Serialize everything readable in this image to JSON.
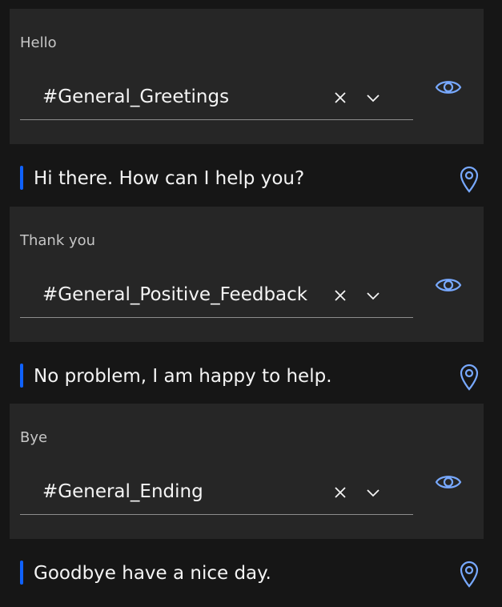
{
  "colors": {
    "background": "#161616",
    "card": "#262626",
    "accent": "#0f62fe",
    "icon": "#78a9ff"
  },
  "blocks": [
    {
      "label": "Hello",
      "intent": "#General_Greetings",
      "reply": "Hi there. How can I help you?"
    },
    {
      "label": "Thank you",
      "intent": "#General_Positive_Feedback",
      "reply": "No problem, I am happy to help."
    },
    {
      "label": "Bye",
      "intent": "#General_Ending",
      "reply": "Goodbye have a nice day."
    }
  ]
}
